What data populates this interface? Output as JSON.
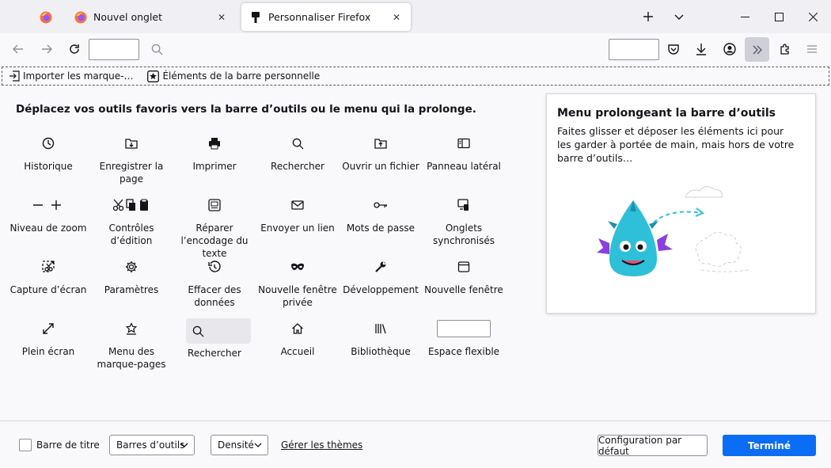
{
  "tabs": {
    "inactive": {
      "title": "Nouvel onglet",
      "close": "✕"
    },
    "active": {
      "title": "Personnaliser Firefox",
      "close": "✕"
    }
  },
  "window_controls": {
    "minimize": "—",
    "maximize": "☐",
    "close": "✕"
  },
  "bookmarks_bar": {
    "import": "Importer les marque-…",
    "personal": "Éléments de la barre personnelle"
  },
  "instructions": "Déplacez vos outils favoris vers la barre d’outils ou le menu qui la prolonge.",
  "palette": [
    {
      "label": "Historique",
      "icon": "history-icon"
    },
    {
      "label": "Enregistrer la page",
      "icon": "save-page-icon"
    },
    {
      "label": "Imprimer",
      "icon": "print-icon"
    },
    {
      "label": "Rechercher",
      "icon": "search-icon"
    },
    {
      "label": "Ouvrir un fichier",
      "icon": "open-file-icon"
    },
    {
      "label": "Panneau latéral",
      "icon": "sidebar-icon"
    },
    {
      "label": "Niveau de zoom",
      "icon": "zoom-icon"
    },
    {
      "label": "Contrôles d’édition",
      "icon": "edit-controls-icon"
    },
    {
      "label": "Réparer l’encodage du texte",
      "icon": "text-encoding-icon"
    },
    {
      "label": "Envoyer un lien",
      "icon": "email-link-icon"
    },
    {
      "label": "Mots de passe",
      "icon": "key-icon"
    },
    {
      "label": "Onglets synchronisés",
      "icon": "synced-tabs-icon"
    },
    {
      "label": "Capture d’écran",
      "icon": "screenshot-icon"
    },
    {
      "label": "Paramètres",
      "icon": "gear-icon"
    },
    {
      "label": "Effacer des données",
      "icon": "forget-icon"
    },
    {
      "label": "Nouvelle fenêtre privée",
      "icon": "private-window-icon"
    },
    {
      "label": "Développement",
      "icon": "wrench-icon"
    },
    {
      "label": "Nouvelle fenêtre",
      "icon": "new-window-icon"
    },
    {
      "label": "Plein écran",
      "icon": "fullscreen-icon"
    },
    {
      "label": "Menu des marque-pages",
      "icon": "bookmarks-menu-icon"
    },
    {
      "label": "Rechercher",
      "icon": "search-icon"
    },
    {
      "label": "Accueil",
      "icon": "home-icon"
    },
    {
      "label": "Bibliothèque",
      "icon": "library-icon"
    },
    {
      "label": "Espace flexible",
      "icon": "flexible-space-icon"
    }
  ],
  "overflow_panel": {
    "title": "Menu prolongeant la barre d’outils",
    "description": "Faites glisser et déposer les éléments ici pour les garder à portée de main, mais hors de votre barre d’outils…"
  },
  "footer": {
    "titlebar_checkbox": "Barre de titre",
    "toolbars_select": "Barres d’outils",
    "density_select": "Densité",
    "manage_themes": "Gérer les thèmes",
    "restore_defaults": "Configuration par défaut",
    "done": "Terminé"
  },
  "colors": {
    "accent": "#0b6cf6",
    "tabstrip": "#f0f0f4",
    "mascot": "#2ec0d8",
    "mascot_wings": "#8a3fe0"
  }
}
